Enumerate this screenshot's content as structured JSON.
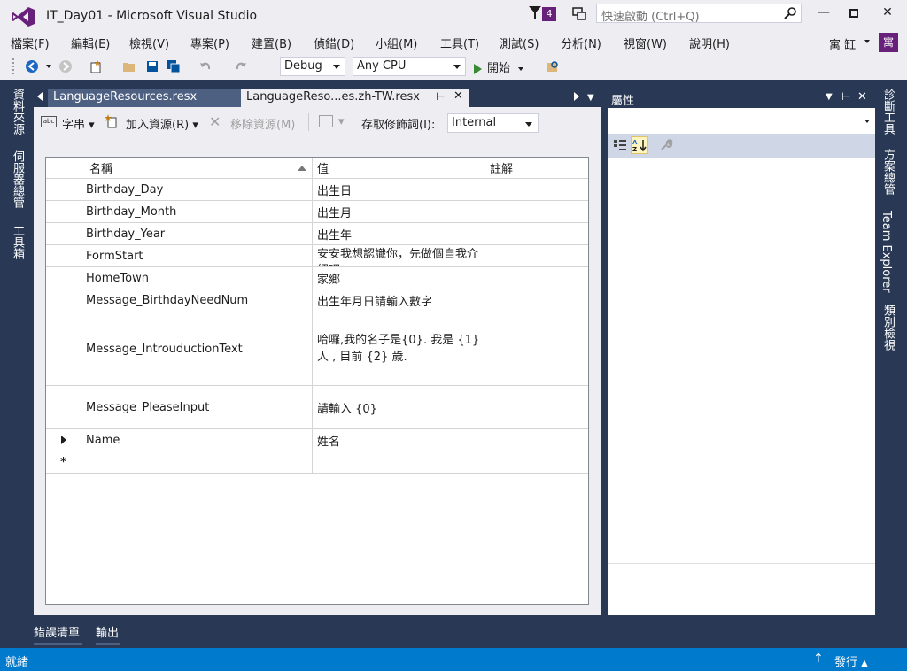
{
  "title": "IT_Day01 - Microsoft Visual Studio",
  "notification_count": "4",
  "quick_launch_placeholder": "快速啟動 (Ctrl+Q)",
  "menu": [
    "檔案(F)",
    "編輯(E)",
    "檢視(V)",
    "專案(P)",
    "建置(B)",
    "偵錯(D)",
    "小組(M)",
    "工具(T)",
    "測試(S)",
    "分析(N)",
    "視窗(W)",
    "說明(H)"
  ],
  "user": {
    "name": "寓 缸",
    "avatar": "寓"
  },
  "toolbar": {
    "config": "Debug",
    "platform": "Any CPU",
    "start": "開始"
  },
  "left_tabs": [
    "資料來源",
    "伺服器總管",
    "工具箱"
  ],
  "right_tabs": [
    "診斷工具",
    "方案總管",
    "Team Explorer",
    "類別檢視"
  ],
  "doc_tabs": [
    "LanguageResources.resx",
    "LanguageReso...es.zh-TW.resx"
  ],
  "resource_toolbar": {
    "strings": "字串",
    "add": "加入資源(R)",
    "remove": "移除資源(M)",
    "access_label": "存取修飾詞(I):",
    "access_value": "Internal"
  },
  "grid": {
    "columns": [
      "名稱",
      "值",
      "註解"
    ],
    "rows": [
      {
        "name": "Birthday_Day",
        "value": "出生日",
        "comment": ""
      },
      {
        "name": "Birthday_Month",
        "value": "出生月",
        "comment": ""
      },
      {
        "name": "Birthday_Year",
        "value": "出生年",
        "comment": ""
      },
      {
        "name": "FormStart",
        "value": "安安我想認識你，先做個自我介紹吧",
        "comment": ""
      },
      {
        "name": "HomeTown",
        "value": "家鄉",
        "comment": ""
      },
      {
        "name": "Message_BirthdayNeedNum",
        "value": "出生年月日請輸入數字",
        "comment": ""
      },
      {
        "name": "Message_IntrouductionText",
        "value": "哈囉,我的名子是{0}. 我是 {1} 人 , 目前 {2} 歲.",
        "comment": ""
      },
      {
        "name": "Message_PleaseInput",
        "value": "請輸入 {0}",
        "comment": ""
      },
      {
        "name": "Name",
        "value": "姓名",
        "comment": ""
      }
    ],
    "new_row_marker": "*"
  },
  "properties": {
    "title": "屬性"
  },
  "bottom_tabs": [
    "錯誤清單",
    "輸出"
  ],
  "status": {
    "left": "就緒",
    "publish": "發行"
  }
}
